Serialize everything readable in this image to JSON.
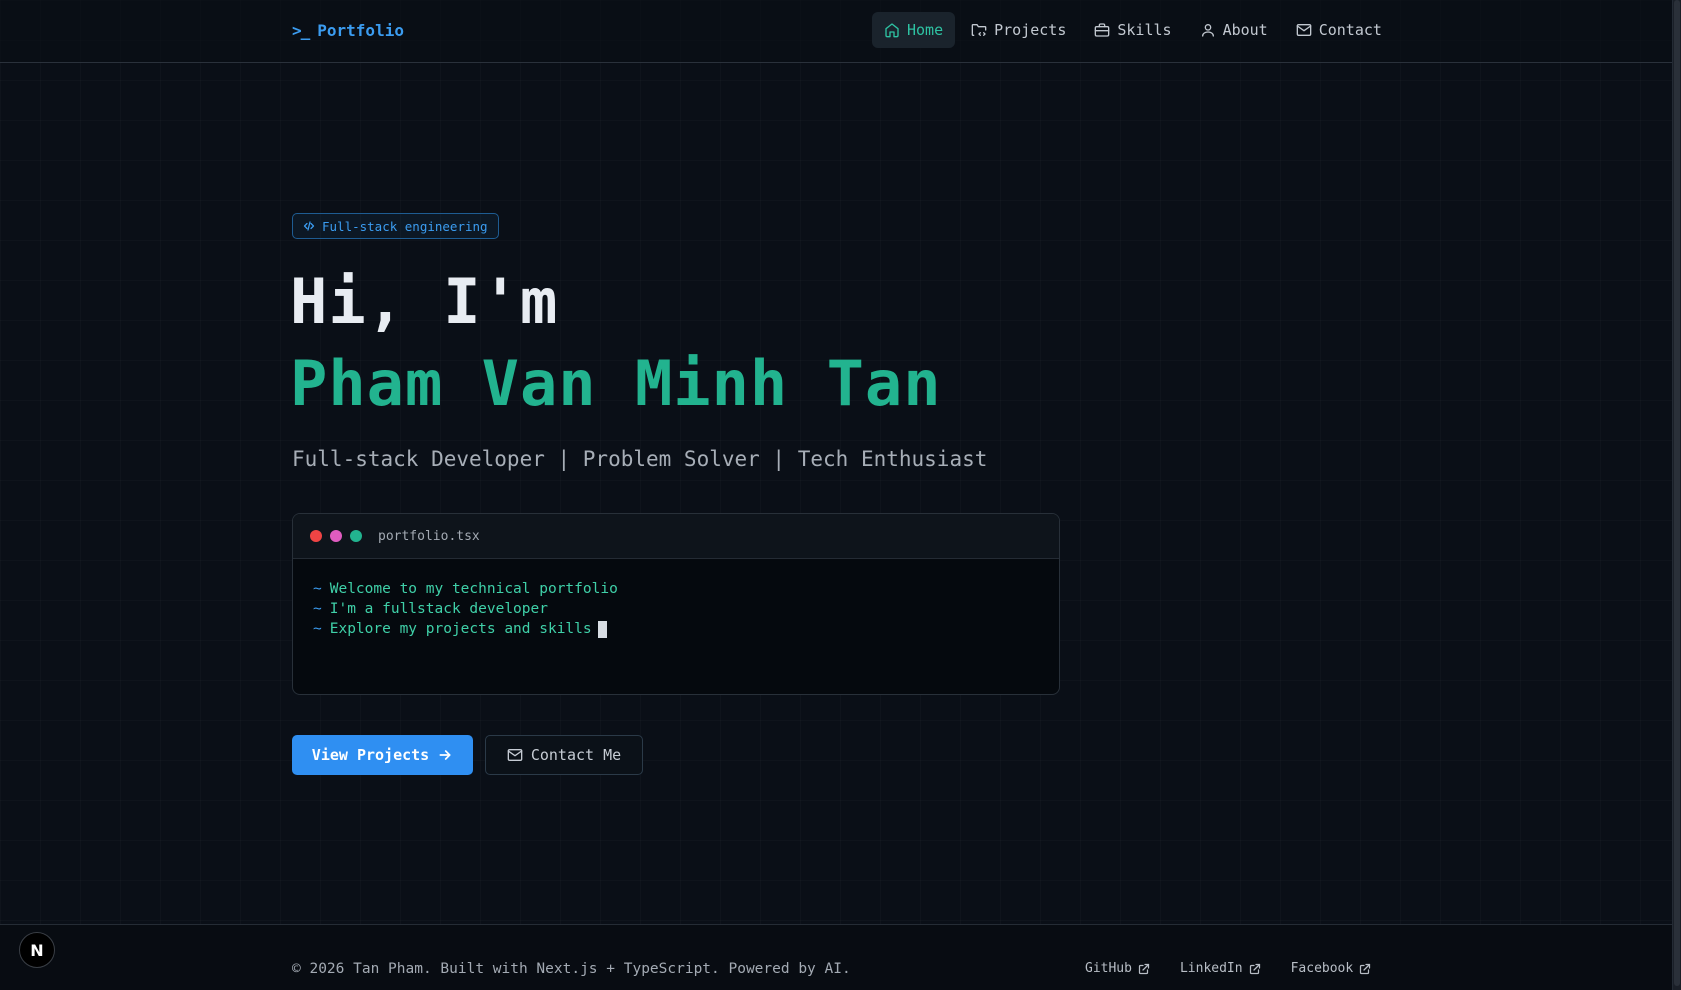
{
  "header": {
    "logo_prompt": ">_",
    "logo_text": "Portfolio",
    "nav": [
      {
        "label": "Home",
        "icon": "home-icon",
        "active": true
      },
      {
        "label": "Projects",
        "icon": "folder-code-icon",
        "active": false
      },
      {
        "label": "Skills",
        "icon": "briefcase-icon",
        "active": false
      },
      {
        "label": "About",
        "icon": "user-icon",
        "active": false
      },
      {
        "label": "Contact",
        "icon": "mail-icon",
        "active": false
      }
    ]
  },
  "hero": {
    "badge": "Full-stack engineering",
    "greeting": "Hi, I'm",
    "name": "Pham Van Minh Tan",
    "tagline": "Full-stack Developer | Problem Solver | Tech Enthusiast"
  },
  "terminal": {
    "filename": "portfolio.tsx",
    "prompt_symbol": "~",
    "lines": [
      "Welcome to my technical portfolio",
      "I'm a fullstack developer",
      "Explore my projects and skills"
    ],
    "dot_colors": [
      "#ef4444",
      "#e05cc0",
      "#22b38f"
    ]
  },
  "actions": {
    "primary_label": "View Projects",
    "secondary_label": "Contact Me"
  },
  "footer": {
    "copyright": "© 2026 Tan Pham. Built with Next.js + TypeScript. Powered by AI.",
    "links": [
      "GitHub",
      "LinkedIn",
      "Facebook"
    ]
  },
  "dev_badge": "N",
  "colors": {
    "accent_blue": "#2f8ff2",
    "accent_green": "#22b38f",
    "background": "#0a0f17"
  }
}
